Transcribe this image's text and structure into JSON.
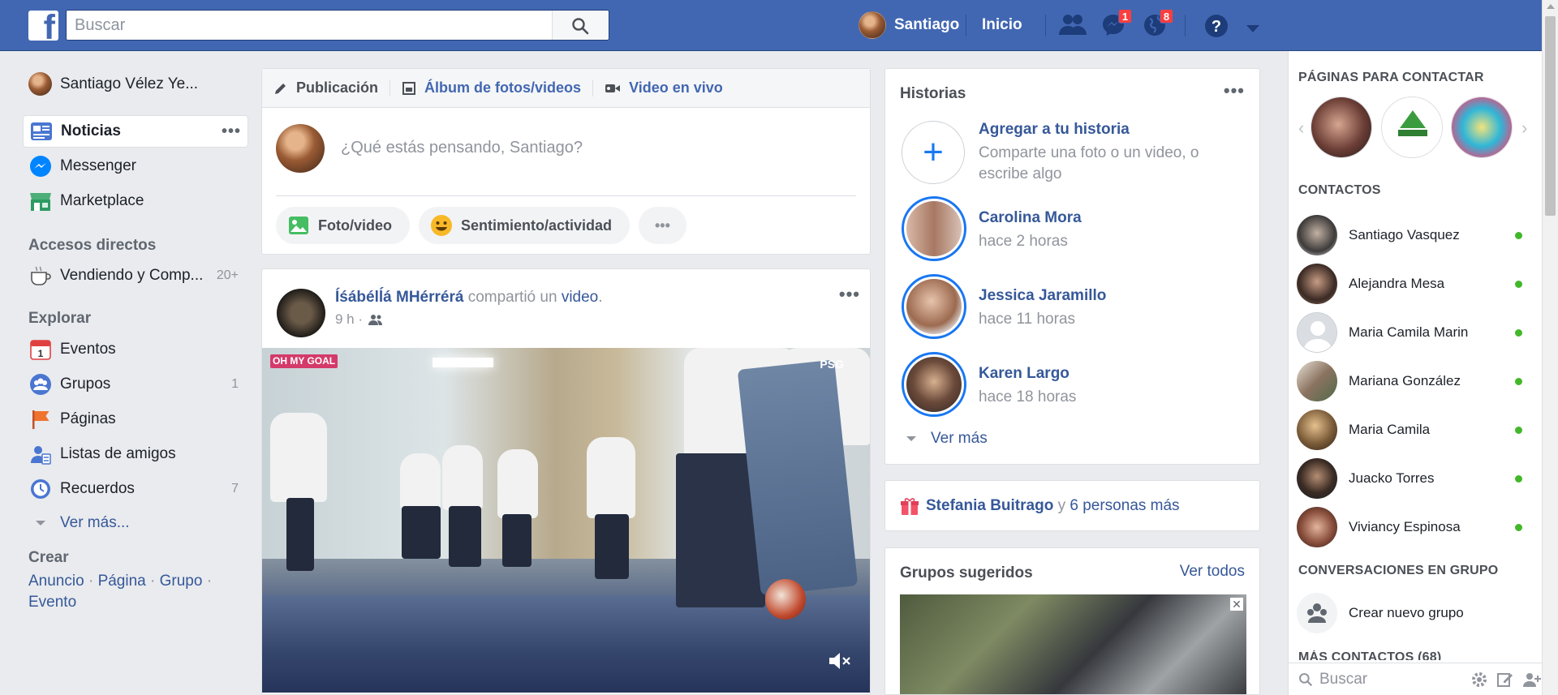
{
  "topbar": {
    "logo_letter": "f",
    "search_placeholder": "Buscar",
    "user_name": "Santiago",
    "home_label": "Inicio",
    "messages_badge": "1",
    "notifications_badge": "8",
    "brand_color": "#4267b2"
  },
  "leftnav": {
    "profile_name": "Santiago Vélez Ye...",
    "items": [
      {
        "label": "Noticias",
        "icon": "news-feed-icon",
        "active": true
      },
      {
        "label": "Messenger",
        "icon": "messenger-icon"
      },
      {
        "label": "Marketplace",
        "icon": "marketplace-icon"
      }
    ],
    "shortcuts_title": "Accesos directos",
    "shortcut": {
      "label": "Vendiendo y Comp...",
      "count": "20+"
    },
    "explore_title": "Explorar",
    "explore": [
      {
        "label": "Eventos",
        "count": ""
      },
      {
        "label": "Grupos",
        "count": "1"
      },
      {
        "label": "Páginas",
        "count": ""
      },
      {
        "label": "Listas de amigos",
        "count": ""
      },
      {
        "label": "Recuerdos",
        "count": "7"
      }
    ],
    "see_more": "Ver más...",
    "create_title": "Crear",
    "create_links": [
      "Anuncio",
      "Página",
      "Grupo",
      "Evento"
    ]
  },
  "composer": {
    "tab_post": "Publicación",
    "tab_album": "Álbum de fotos/videos",
    "tab_live": "Video en vivo",
    "placeholder": "¿Qué estás pensando, Santiago?",
    "photo_btn": "Foto/video",
    "feeling_btn": "Sentimiento/actividad",
    "more_btn": "•••"
  },
  "post": {
    "author": "Íśábélĺá MHérrérá",
    "action_pre": "compartió un",
    "action_link": "video",
    "action_post": ".",
    "time": "9 h ·",
    "video_logo": "OH MY GOAL",
    "video_tag": "PSG"
  },
  "stories": {
    "title": "Historias",
    "add_title": "Agregar a tu historia",
    "add_sub": "Comparte una foto o un video, o escribe algo",
    "items": [
      {
        "name": "Carolina Mora",
        "time": "hace 2 horas"
      },
      {
        "name": "Jessica Jaramillo",
        "time": "hace 11 horas"
      },
      {
        "name": "Karen Largo",
        "time": "hace 18 horas"
      }
    ],
    "see_more": "Ver más"
  },
  "birthday": {
    "name": "Stefania Buitrago",
    "conj": "y",
    "others": "6 personas más"
  },
  "groups": {
    "title": "Grupos sugeridos",
    "see_all": "Ver todos"
  },
  "sidebar": {
    "pages_title": "PÁGINAS PARA CONTACTAR",
    "contacts_title": "CONTACTOS",
    "contacts": [
      {
        "name": "Santiago Vasquez"
      },
      {
        "name": "Alejandra Mesa"
      },
      {
        "name": "Maria Camila Marin"
      },
      {
        "name": "Mariana González"
      },
      {
        "name": "Maria Camila"
      },
      {
        "name": "Juacko Torres"
      },
      {
        "name": "Viviancy Espinosa"
      }
    ],
    "group_conv_title": "CONVERSACIONES EN GRUPO",
    "new_group": "Crear nuevo grupo",
    "more_contacts": "MÁS CONTACTOS (68)",
    "chat_search_placeholder": "Buscar"
  }
}
